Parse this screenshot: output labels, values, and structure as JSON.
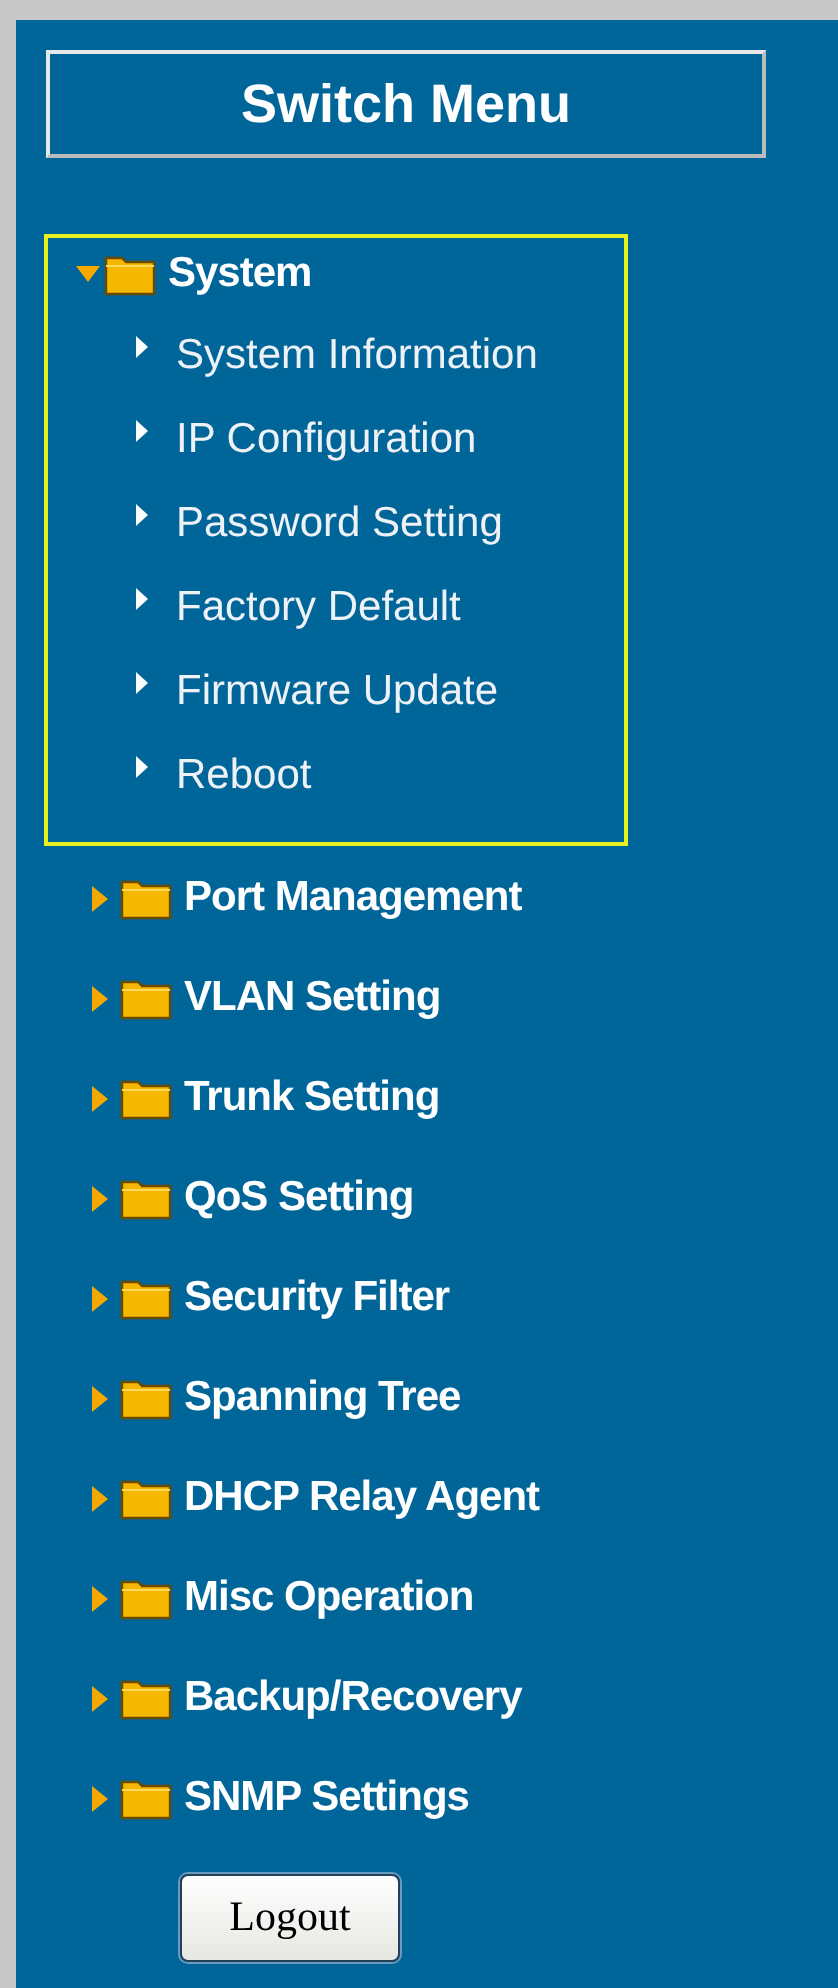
{
  "title": "Switch Menu",
  "folders": [
    {
      "label": "System",
      "expanded": true,
      "children": [
        {
          "label": "System Information"
        },
        {
          "label": "IP Configuration"
        },
        {
          "label": "Password Setting"
        },
        {
          "label": "Factory Default"
        },
        {
          "label": "Firmware Update"
        },
        {
          "label": "Reboot"
        }
      ]
    },
    {
      "label": "Port Management",
      "expanded": false
    },
    {
      "label": "VLAN Setting",
      "expanded": false
    },
    {
      "label": "Trunk Setting",
      "expanded": false
    },
    {
      "label": "QoS Setting",
      "expanded": false
    },
    {
      "label": "Security Filter",
      "expanded": false
    },
    {
      "label": "Spanning Tree",
      "expanded": false
    },
    {
      "label": "DHCP Relay Agent",
      "expanded": false
    },
    {
      "label": "Misc Operation",
      "expanded": false
    },
    {
      "label": "Backup/Recovery",
      "expanded": false
    },
    {
      "label": "SNMP Settings",
      "expanded": false
    }
  ],
  "logout_button": "Logout"
}
